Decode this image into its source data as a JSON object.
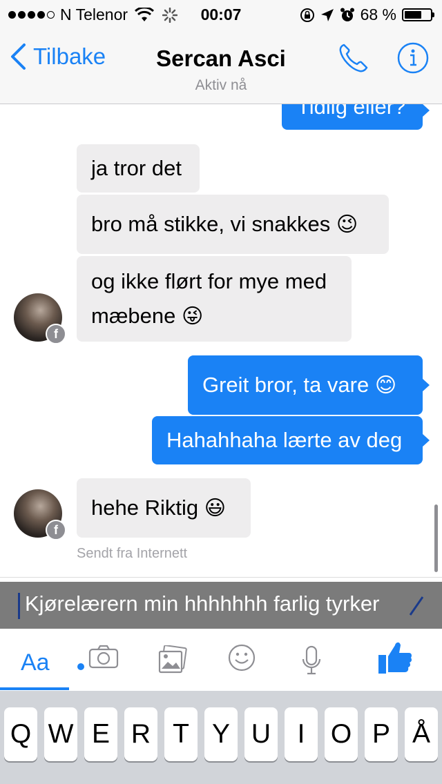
{
  "status_bar": {
    "carrier": "N Telenor",
    "time": "00:07",
    "battery": "68 %",
    "battery_level": 0.68,
    "signal_dots": 4,
    "icons": [
      "wifi-icon",
      "activity-spinner-icon",
      "rotation-lock-icon",
      "location-arrow-icon",
      "alarm-icon",
      "battery-icon"
    ]
  },
  "nav": {
    "back_label": "Tilbake",
    "title": "Sercan Asci",
    "subtitle": "Aktiv nå",
    "icons": [
      "chevron-left-icon",
      "phone-icon",
      "info-icon"
    ]
  },
  "messages": [
    {
      "dir": "out",
      "text": "Tidlig eller?"
    },
    {
      "dir": "in",
      "text": "ja tror det"
    },
    {
      "dir": "in",
      "text": "bro må stikke, vi snakkes",
      "emoji": "😉"
    },
    {
      "dir": "in",
      "line1": "og ikke flørt for mye med",
      "line2": "mæbene",
      "emoji": "😜"
    },
    {
      "dir": "out",
      "text": "Greit bror, ta vare",
      "emoji": "😊"
    },
    {
      "dir": "out",
      "text": "Hahahhaha lærte av deg"
    },
    {
      "dir": "in",
      "text": "hehe Riktig",
      "emoji": "😃"
    }
  ],
  "sent_note": "Sendt fra Internett",
  "composer": {
    "draft_text": "Kjørelærern min hhhhhhh farlig tyrker",
    "aa_label": "Aa",
    "icons": [
      "camera-icon",
      "photo-gallery-icon",
      "smiley-icon",
      "microphone-icon",
      "thumbs-up-icon"
    ]
  },
  "keyboard": {
    "row1": [
      "Q",
      "W",
      "E",
      "R",
      "T",
      "Y",
      "U",
      "I",
      "O",
      "P",
      "Å"
    ]
  },
  "colors": {
    "accent": "#1a82f5",
    "incoming_bubble": "#eeedee",
    "keyboard_bg": "#d1d4d9"
  }
}
